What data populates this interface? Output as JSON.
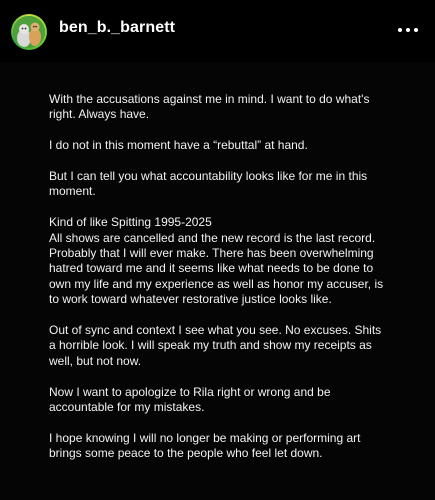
{
  "header": {
    "username": "ben_b._barnett",
    "avatar_icon": "cartoon-avatar-icon",
    "more_icon": "more-options-icon"
  },
  "post": {
    "paragraphs": [
      "With the accusations against me in mind. I want to do what's right. Always have.",
      "I do not in this moment have a “rebuttal” at hand.",
      "But I can tell you what accountability looks like for me in this moment.",
      "Kind of like Spitting 1995-2025\nAll shows are cancelled and the new record is the last record. Probably that I will ever make. There has been overwhelming hatred toward me and it seems like what needs to be done to own my life and my experience as well as honor my accuser, is to work toward whatever restorative justice looks like.",
      "Out of sync and context I see what you see. No excuses. Shits a horrible look. I will speak my truth and show my receipts as well, but not now.",
      "Now I want to apologize to Rila right or wrong and be accountable for my mistakes.",
      "I hope knowing I will no longer be making or performing art brings some peace to the people who feel let down."
    ]
  }
}
